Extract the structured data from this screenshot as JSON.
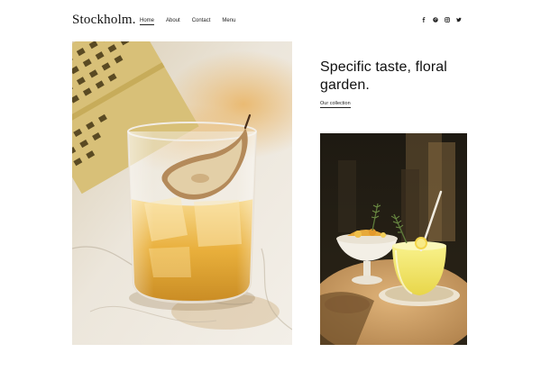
{
  "header": {
    "logo": "Stockholm.",
    "nav": [
      {
        "label": "Home",
        "active": true
      },
      {
        "label": "About",
        "active": false
      },
      {
        "label": "Contact",
        "active": false
      },
      {
        "label": "Menu",
        "active": false
      }
    ],
    "social_icons": [
      "facebook-icon",
      "pinterest-icon",
      "instagram-icon",
      "twitter-icon"
    ]
  },
  "hero": {
    "headline": "Specific taste, floral garden.",
    "link_label": "Our collection"
  },
  "colors": {
    "text": "#111111",
    "background": "#ffffff",
    "accent_drink": "#e8b53a"
  }
}
